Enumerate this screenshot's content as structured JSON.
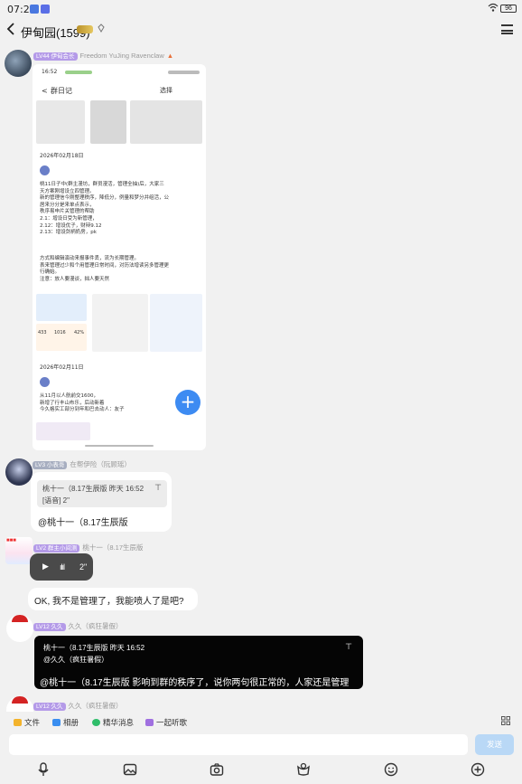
{
  "status": {
    "time": "07:28",
    "battery": "96"
  },
  "header": {
    "back_icon": "chevron-left-icon",
    "title": "伊甸园(1599)",
    "menu_icon": "hamburger-icon"
  },
  "messages": {
    "m1": {
      "level": "LV44 伊甸会长",
      "sender": "Freedom YuJing Ravenclaw"
    },
    "shot": {
      "time": "16:52",
      "title": "群日记",
      "btn": "选择",
      "date1": "2026年02月18日",
      "body1": "桃11日子中(群主漫坊，群员漫活，管理全抽)后，大家三\n天方案刚增设立四管理。\n新的管理信今刚整理秩序，降低分，例量和梦分并组活，公\n居来分分是来单点表示，\n秩序易申片关管理的帮助\n2.1：增设日受为新管理，\n2.12：增设优子，财辩9.12\n2.13：增设剑柄奶房，pk",
      "body2": "方式和编辑演动来报事件丢，流为长期管理。\n表来管理过少和个用管理日常时间，对历法增读另多管理更\n行确始。\n注意：放人要漫谈，拙人要天然",
      "date2": "2026年02月11日",
      "body3": "从11月以人航前交1600，\n新增了行丰山布乐，后动新着\n今久格实工部分到年和巴去动人：友子",
      "stats": [
        "433",
        "1016",
        "42%"
      ]
    },
    "m2": {
      "level": "LV3 小表哥",
      "sender": "在帮伊险（阮顾瑶）",
      "quote_line1": "桃十一（8.17生辰版 昨天 16:52",
      "quote_line2": "[语音] 2\"",
      "text": "@桃十一（8.17生辰版"
    },
    "m3": {
      "level": "LV2 群主小间测",
      "sender": "桃十一（8.17生辰版",
      "voice": "2\"",
      "text": "OK, 我不是管理了，我能喷人了是吧?"
    },
    "m4": {
      "level": "LV12 久久",
      "sender": "久久（疯狂暑假）",
      "quote_line1": "桃十一（8.17生辰版 昨天 16:52",
      "quote_line2": "@久久（疯狂暑假）",
      "text": "@桃十一（8.17生辰版 影响到群的秩序了，说你两句很正常的，人家还是管理"
    },
    "m5": {
      "level": "LV12 久久",
      "sender": "久久（疯狂暑假）"
    }
  },
  "toolbar": {
    "files": "文件",
    "album": "相册",
    "essence": "精华消息",
    "music": "一起听歌"
  },
  "input": {
    "placeholder": "",
    "send": "发送"
  },
  "colors": {
    "accent": "#3d8bf2",
    "level_badge": "#b49ae8",
    "send_disabled": "#b9d8f6"
  }
}
